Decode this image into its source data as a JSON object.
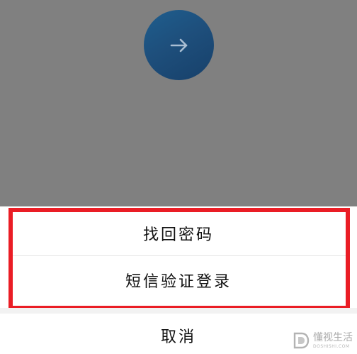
{
  "overlay": {
    "next_button": {
      "icon": "arrow-right-icon"
    }
  },
  "action_sheet": {
    "options": [
      {
        "label": "找回密码"
      },
      {
        "label": "短信验证登录"
      }
    ],
    "cancel_label": "取消"
  },
  "annotation": {
    "highlight_color": "#ea1d25"
  },
  "watermark": {
    "text": "懂视生活",
    "subtext": "DOSHISHI.COM",
    "icon": "logo-icon"
  },
  "colors": {
    "overlay": "#808080",
    "button": "#1e4f7c",
    "sheet": "#ffffff"
  }
}
